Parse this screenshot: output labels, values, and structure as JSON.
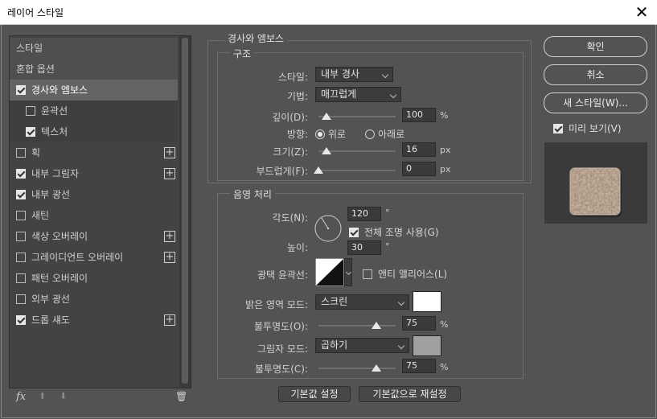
{
  "window": {
    "title": "레이어 스타일",
    "close": "✕"
  },
  "left_panel": {
    "items": [
      {
        "label": "스타일"
      },
      {
        "label": "혼합 옵션"
      },
      {
        "label": "경사와 엠보스",
        "checked": true
      },
      {
        "label": "윤곽선",
        "checked": false
      },
      {
        "label": "텍스처",
        "checked": true
      },
      {
        "label": "획",
        "checked": false,
        "plus": true
      },
      {
        "label": "내부 그림자",
        "checked": true,
        "plus": true
      },
      {
        "label": "내부 광선",
        "checked": true
      },
      {
        "label": "새틴",
        "checked": false
      },
      {
        "label": "색상 오버레이",
        "checked": false,
        "plus": true
      },
      {
        "label": "그레이디언트 오버레이",
        "checked": false,
        "plus": true
      },
      {
        "label": "패턴 오버레이",
        "checked": false
      },
      {
        "label": "외부 광선",
        "checked": false
      },
      {
        "label": "드롭 섀도",
        "checked": true,
        "plus": true
      }
    ],
    "plus_glyph": "+",
    "fx": "fx",
    "up": "⬆",
    "down": "⬇",
    "trash": "🗑"
  },
  "bevel": {
    "group_title": "경사와 엠보스",
    "structure_title": "구조",
    "style_label": "스타일:",
    "style_value": "내부 경사",
    "technique_label": "기법:",
    "technique_value": "매끄럽게",
    "depth_label": "깊이(D):",
    "depth_value": "100",
    "depth_unit": "%",
    "depth_level": 0.1,
    "direction_label": "방향:",
    "direction_up": "위로",
    "direction_down": "아래로",
    "size_label": "크기(Z):",
    "size_value": "16",
    "size_unit": "px",
    "size_level": 0.1,
    "soften_label": "부드럽게(F):",
    "soften_value": "0",
    "soften_unit": "px",
    "soften_level": 0.0
  },
  "shading": {
    "title": "음영 처리",
    "angle_label": "각도(N):",
    "angle_value": "120",
    "angle_unit": "°",
    "global_light": "전체 조명 사용(G)",
    "altitude_label": "높이:",
    "altitude_value": "30",
    "altitude_unit": "°",
    "gloss_label": "광택 윤곽선:",
    "anti_alias": "앤티 앨리어스(L)",
    "highlight_label": "밝은 영역 모드:",
    "highlight_mode": "스크린",
    "highlight_color": "#ffffff",
    "opacity1_label": "불투명도(O):",
    "opacity1_value": "75",
    "opacity1_unit": "%",
    "opacity1_level": 0.75,
    "shadow_label": "그림자 모드:",
    "shadow_mode": "곱하기",
    "shadow_color": "#a0a0a0",
    "opacity2_label": "불투명도(C):",
    "opacity2_value": "75",
    "opacity2_unit": "%",
    "opacity2_level": 0.75
  },
  "bottom_buttons": {
    "default": "기본값 설정",
    "reset": "기본값으로 재설정"
  },
  "right": {
    "ok": "확인",
    "cancel": "취소",
    "new_style": "새 스타일(W)...",
    "preview": "미리 보기(V)"
  }
}
